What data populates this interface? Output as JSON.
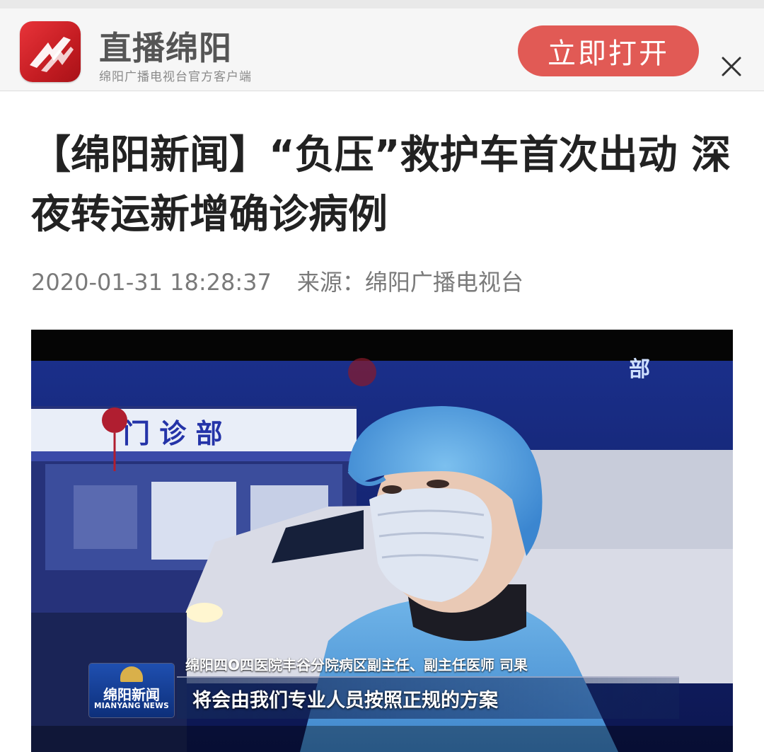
{
  "banner": {
    "app_name": "直播绵阳",
    "slogan": "绵阳广播电视台官方客户端",
    "open_button": "立即打开"
  },
  "article": {
    "headline": "【绵阳新闻】“负压”救护车首次出动 深夜转运新增确诊病例",
    "datetime": "2020-01-31 18:28:37",
    "source": "来源：绵阳广播电视台"
  },
  "video": {
    "station_logo_cn": "绵阳新闻",
    "station_logo_en": "MIANYANG NEWS",
    "speaker": "绵阳四O四医院丰谷分院病区副主任、副主任医师 司果",
    "subtitle": "将会由我们专业人员按照正规的方案"
  },
  "colors": {
    "accent": "#e15a55",
    "logo_red": "#d8262c",
    "headline": "#222222",
    "meta": "#7a7a7a"
  }
}
